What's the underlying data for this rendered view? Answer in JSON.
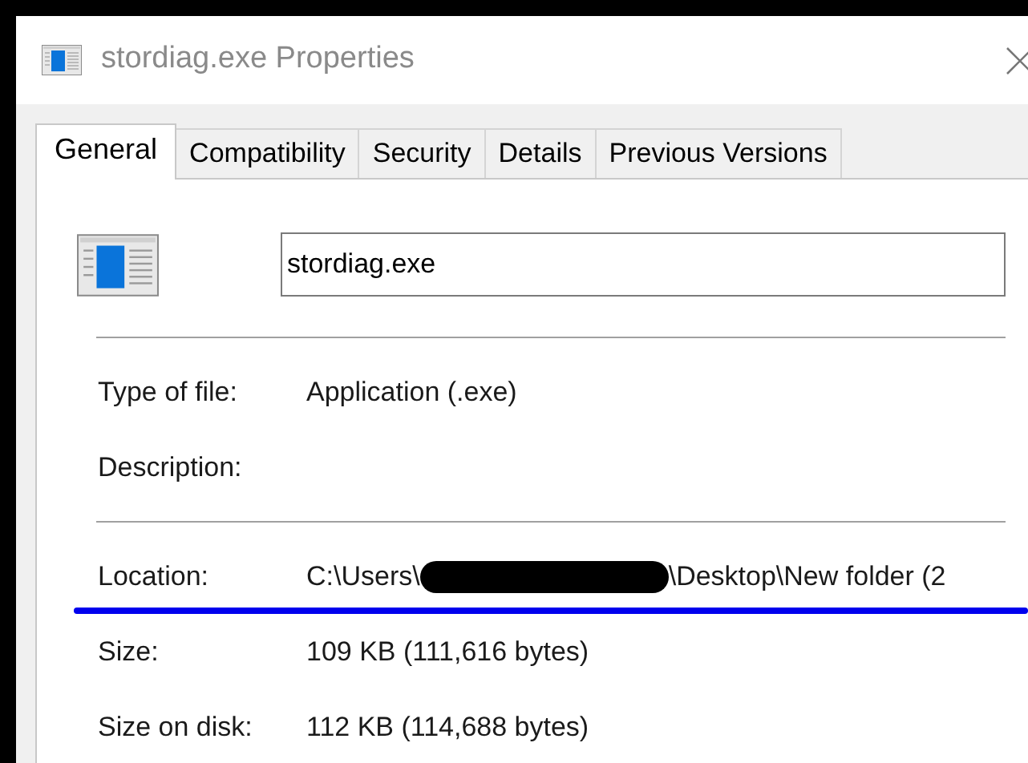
{
  "window": {
    "title": "stordiag.exe Properties"
  },
  "tabs": [
    {
      "label": "General",
      "selected": true
    },
    {
      "label": "Compatibility",
      "selected": false
    },
    {
      "label": "Security",
      "selected": false
    },
    {
      "label": "Details",
      "selected": false
    },
    {
      "label": "Previous Versions",
      "selected": false
    }
  ],
  "file_name": {
    "value": "stordiag.exe"
  },
  "sections": [
    {
      "rows": [
        {
          "label": "Type of file:",
          "value": "Application (.exe)"
        },
        {
          "label": "Description:"
        }
      ]
    },
    {
      "rows": [
        {
          "label": "Location:",
          "value": "C:\\Users\\",
          "redacted": true,
          "value_after": "\\Desktop\\New folder (2",
          "underlined": true
        },
        {
          "label": "Size:",
          "value": "109 KB (111,616 bytes)"
        },
        {
          "label": "Size on disk:",
          "value": "112 KB (114,688 bytes)"
        }
      ]
    }
  ]
}
